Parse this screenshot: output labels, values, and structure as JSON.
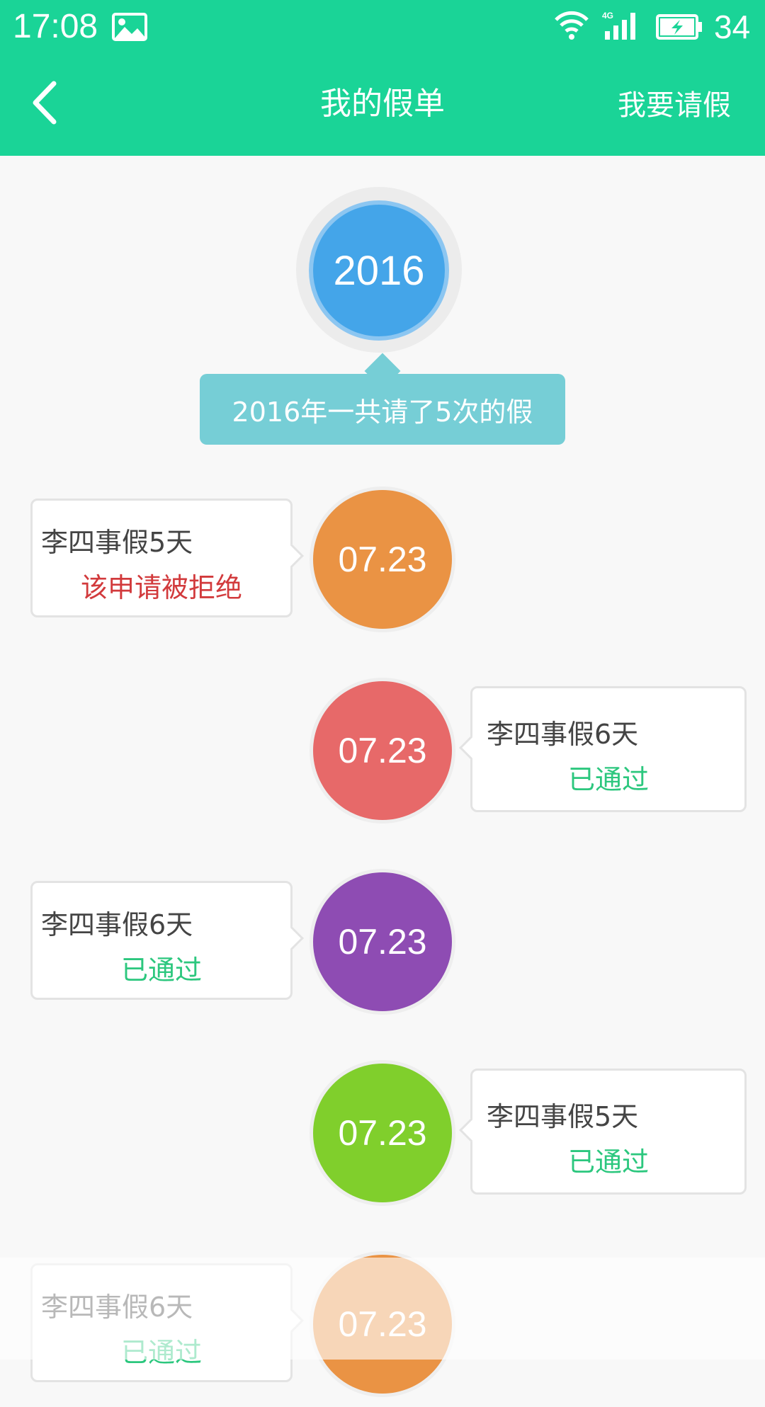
{
  "status_bar": {
    "time": "17:08",
    "battery": "34",
    "network": "4G"
  },
  "header": {
    "title": "我的假单",
    "action": "我要请假",
    "color": "#1ad497"
  },
  "year": {
    "label": "2016",
    "summary": "2016年一共请了5次的假",
    "color": "#44a5e9"
  },
  "entries": [
    {
      "date": "07.23",
      "title": "李四事假5天",
      "status": "该申请被拒绝",
      "side": "left",
      "color": "#ea9344",
      "status_color": "#d23a3c"
    },
    {
      "date": "07.23",
      "title": "李四事假6天",
      "status": "已通过",
      "side": "right",
      "color": "#e76969",
      "status_color": "#2cc77e"
    },
    {
      "date": "07.23",
      "title": "李四事假6天",
      "status": "已通过",
      "side": "left",
      "color": "#8e4cb3",
      "status_color": "#2cc77e"
    },
    {
      "date": "07.23",
      "title": "李四事假5天",
      "status": "已通过",
      "side": "right",
      "color": "#80cf2c",
      "status_color": "#2cc77e"
    },
    {
      "date": "07.23",
      "title": "李四事假6天",
      "status": "已通过",
      "side": "left",
      "color": "#ea9344",
      "status_color": "#2cc77e"
    }
  ]
}
